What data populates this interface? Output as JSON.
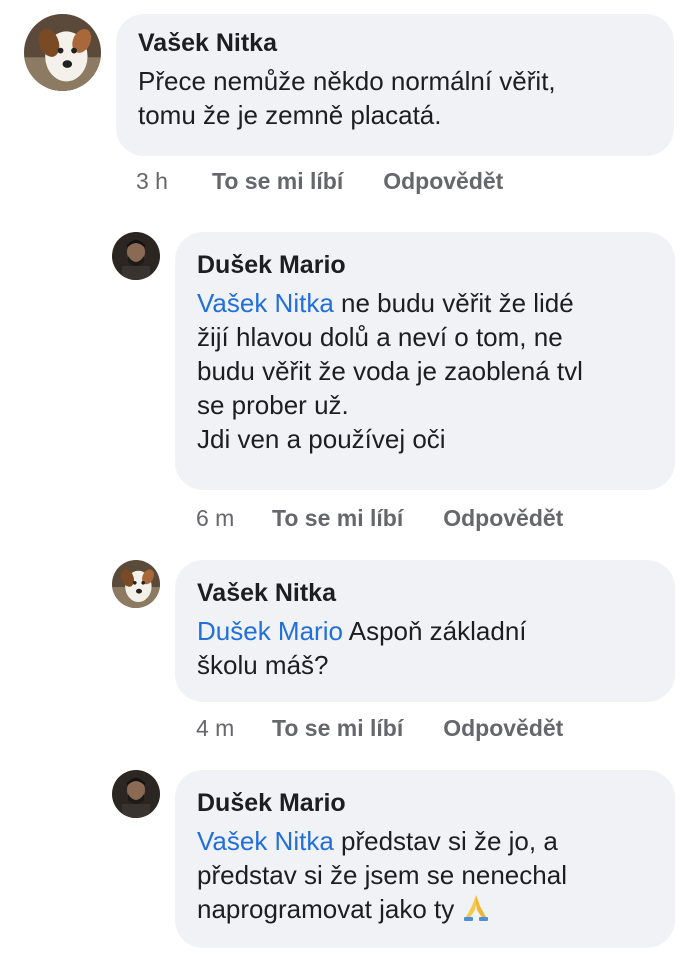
{
  "comments": [
    {
      "author": "Vašek Nitka",
      "avatar_icon": "dog-avatar-icon",
      "lines": [
        "Přece nemůže někdo normální věřit,",
        "tomu že je zemně placatá."
      ],
      "time": "3 h",
      "like_label": "To se mi líbí",
      "reply_label": "Odpovědět"
    },
    {
      "author": "Dušek Mario",
      "avatar_icon": "man-avatar-icon",
      "mention": "Vašek Nitka",
      "first_line_rest": " ne budu věřit že lidé",
      "lines": [
        "žijí hlavou dolů a neví o tom,  ne",
        "budu věřit že voda je zaoblená tvl",
        "se prober už.",
        "Jdi ven a používej oči"
      ],
      "time": "6 m",
      "like_label": "To se mi líbí",
      "reply_label": "Odpovědět"
    },
    {
      "author": "Vašek Nitka",
      "avatar_icon": "dog-avatar-icon",
      "mention": "Dušek Mario",
      "first_line_rest": " Aspoň základní",
      "lines": [
        "školu máš?"
      ],
      "time": "4 m",
      "like_label": "To se mi líbí",
      "reply_label": "Odpovědět"
    },
    {
      "author": "Dušek Mario",
      "avatar_icon": "man-avatar-icon",
      "mention": "Vašek Nitka",
      "first_line_rest": " představ si že jo,  a",
      "lines": [
        "představ si že jsem se nenechal",
        "naprogramovat jako ty "
      ],
      "emoji": "folded-hands-icon"
    }
  ],
  "colors": {
    "bubble_bg": "#f0f2f5",
    "mention": "#216fdb",
    "meta_text": "#65676b",
    "author_text": "#1c1e21"
  }
}
